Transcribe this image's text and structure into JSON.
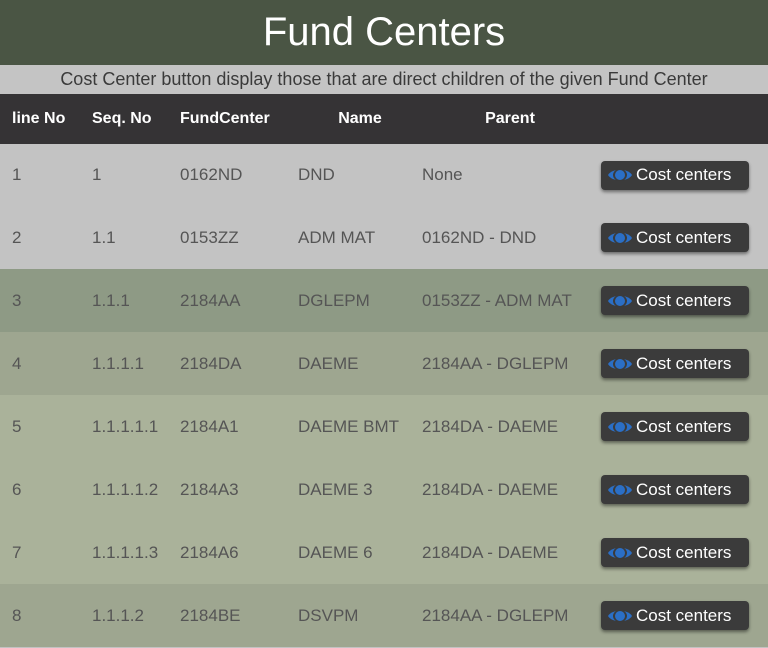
{
  "header": {
    "title": "Fund Centers",
    "subtitle": "Cost Center button display those that are direct children of the given Fund Center"
  },
  "table": {
    "columns": [
      "line No",
      "Seq. No",
      "FundCenter",
      "Name",
      "Parent",
      ""
    ],
    "button_label": "Cost centers",
    "rows": [
      {
        "line": "1",
        "seq": "1",
        "fc": "0162ND",
        "name": "DND",
        "parent": "None",
        "bg": "#c3c3c3"
      },
      {
        "line": "2",
        "seq": "1.1",
        "fc": "0153ZZ",
        "name": "ADM MAT",
        "parent": "0162ND - DND",
        "bg": "#c3c3c3"
      },
      {
        "line": "3",
        "seq": "1.1.1",
        "fc": "2184AA",
        "name": "DGLEPM",
        "parent": "0153ZZ - ADM MAT",
        "bg": "#8e9a85"
      },
      {
        "line": "4",
        "seq": "1.1.1.1",
        "fc": "2184DA",
        "name": "DAEME",
        "parent": "2184AA - DGLEPM",
        "bg": "#9ea690"
      },
      {
        "line": "5",
        "seq": "1.1.1.1.1",
        "fc": "2184A1",
        "name": "DAEME BMT",
        "parent": "2184DA - DAEME",
        "bg": "#aab29a"
      },
      {
        "line": "6",
        "seq": "1.1.1.1.2",
        "fc": "2184A3",
        "name": "DAEME 3",
        "parent": "2184DA - DAEME",
        "bg": "#aab29a"
      },
      {
        "line": "7",
        "seq": "1.1.1.1.3",
        "fc": "2184A6",
        "name": "DAEME 6",
        "parent": "2184DA - DAEME",
        "bg": "#aab29a"
      },
      {
        "line": "8",
        "seq": "1.1.1.2",
        "fc": "2184BE",
        "name": "DSVPM",
        "parent": "2184AA - DGLEPM",
        "bg": "#9ea690"
      }
    ]
  },
  "colors": {
    "banner": "#4a5544",
    "table_header": "#353335",
    "button": "#3b3b3b",
    "eye_icon": "#2b6fc6"
  },
  "icons": {
    "button_icon": "eye-icon"
  }
}
